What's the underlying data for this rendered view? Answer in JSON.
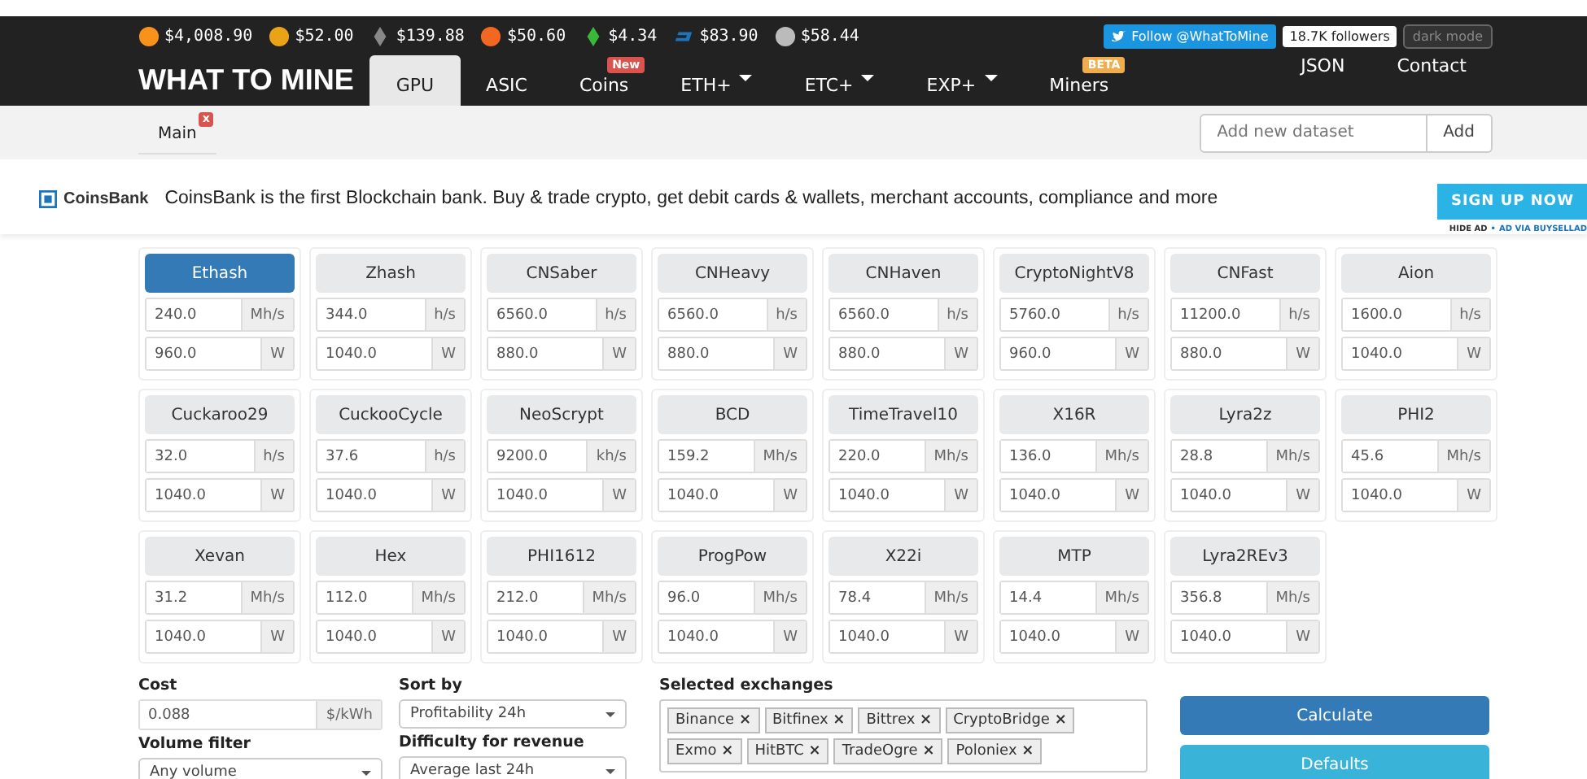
{
  "ticker": [
    {
      "kind": "bitcoin",
      "price": "$4,008.90"
    },
    {
      "kind": "zcash",
      "price": "$52.00"
    },
    {
      "kind": "ethereum",
      "price": "$139.88"
    },
    {
      "kind": "monero",
      "price": "$50.60"
    },
    {
      "kind": "classic",
      "price": "$4.34"
    },
    {
      "kind": "dash",
      "price": "$83.90"
    },
    {
      "kind": "litecoin",
      "price": "$58.44"
    }
  ],
  "social": {
    "follow": "Follow @WhatToMine",
    "followers": "18.7K followers",
    "dark_mode": "dark mode"
  },
  "brand": "WHAT TO MINE",
  "nav": [
    {
      "label": "GPU",
      "selected": true,
      "dropdown": false
    },
    {
      "label": "ASIC",
      "selected": false,
      "dropdown": false
    },
    {
      "label": "Coins",
      "selected": false,
      "dropdown": false,
      "badge": {
        "text": "New",
        "color": "#d9534f"
      }
    },
    {
      "label": "ETH+",
      "selected": false,
      "dropdown": true
    },
    {
      "label": "ETC+",
      "selected": false,
      "dropdown": true
    },
    {
      "label": "EXP+",
      "selected": false,
      "dropdown": true
    },
    {
      "label": "Miners",
      "selected": false,
      "dropdown": false,
      "badge": {
        "text": "BETA",
        "color": "#f0ad4e"
      }
    }
  ],
  "nav_right": [
    "JSON",
    "Contact"
  ],
  "datasets": [
    {
      "label": "Main",
      "selected": true,
      "close": "x"
    }
  ],
  "dataset_field": {
    "placeholder": "Add new dataset",
    "button": "Add"
  },
  "ad": {
    "brand": "CoinsBank",
    "text": "CoinsBank is the first Blockchain bank. Buy & trade crypto, get debit cards & wallets, merchant accounts, compliance and more",
    "cta": "SIGN UP NOW",
    "hide": "HIDE AD",
    "separator": "•",
    "via": "AD VIA BUYSELLAD"
  },
  "algorithms": [
    {
      "name": "Ethash",
      "selected": true,
      "hashrate": "240.0",
      "unit": "Mh/s",
      "power": "960.0",
      "power_unit": "W"
    },
    {
      "name": "Zhash",
      "selected": false,
      "hashrate": "344.0",
      "unit": "h/s",
      "power": "1040.0",
      "power_unit": "W"
    },
    {
      "name": "CNSaber",
      "selected": false,
      "hashrate": "6560.0",
      "unit": "h/s",
      "power": "880.0",
      "power_unit": "W"
    },
    {
      "name": "CNHeavy",
      "selected": false,
      "hashrate": "6560.0",
      "unit": "h/s",
      "power": "880.0",
      "power_unit": "W"
    },
    {
      "name": "CNHaven",
      "selected": false,
      "hashrate": "6560.0",
      "unit": "h/s",
      "power": "880.0",
      "power_unit": "W"
    },
    {
      "name": "CryptoNightV8",
      "selected": false,
      "hashrate": "5760.0",
      "unit": "h/s",
      "power": "960.0",
      "power_unit": "W"
    },
    {
      "name": "CNFast",
      "selected": false,
      "hashrate": "11200.0",
      "unit": "h/s",
      "power": "880.0",
      "power_unit": "W"
    },
    {
      "name": "Aion",
      "selected": false,
      "hashrate": "1600.0",
      "unit": "h/s",
      "power": "1040.0",
      "power_unit": "W"
    },
    {
      "name": "Cuckaroo29",
      "selected": false,
      "hashrate": "32.0",
      "unit": "h/s",
      "power": "1040.0",
      "power_unit": "W"
    },
    {
      "name": "CuckooCycle",
      "selected": false,
      "hashrate": "37.6",
      "unit": "h/s",
      "power": "1040.0",
      "power_unit": "W"
    },
    {
      "name": "NeoScrypt",
      "selected": false,
      "hashrate": "9200.0",
      "unit": "kh/s",
      "power": "1040.0",
      "power_unit": "W"
    },
    {
      "name": "BCD",
      "selected": false,
      "hashrate": "159.2",
      "unit": "Mh/s",
      "power": "1040.0",
      "power_unit": "W"
    },
    {
      "name": "TimeTravel10",
      "selected": false,
      "hashrate": "220.0",
      "unit": "Mh/s",
      "power": "1040.0",
      "power_unit": "W"
    },
    {
      "name": "X16R",
      "selected": false,
      "hashrate": "136.0",
      "unit": "Mh/s",
      "power": "1040.0",
      "power_unit": "W"
    },
    {
      "name": "Lyra2z",
      "selected": false,
      "hashrate": "28.8",
      "unit": "Mh/s",
      "power": "1040.0",
      "power_unit": "W"
    },
    {
      "name": "PHI2",
      "selected": false,
      "hashrate": "45.6",
      "unit": "Mh/s",
      "power": "1040.0",
      "power_unit": "W"
    },
    {
      "name": "Xevan",
      "selected": false,
      "hashrate": "31.2",
      "unit": "Mh/s",
      "power": "1040.0",
      "power_unit": "W"
    },
    {
      "name": "Hex",
      "selected": false,
      "hashrate": "112.0",
      "unit": "Mh/s",
      "power": "1040.0",
      "power_unit": "W"
    },
    {
      "name": "PHI1612",
      "selected": false,
      "hashrate": "212.0",
      "unit": "Mh/s",
      "power": "1040.0",
      "power_unit": "W"
    },
    {
      "name": "ProgPow",
      "selected": false,
      "hashrate": "96.0",
      "unit": "Mh/s",
      "power": "1040.0",
      "power_unit": "W"
    },
    {
      "name": "X22i",
      "selected": false,
      "hashrate": "78.4",
      "unit": "Mh/s",
      "power": "1040.0",
      "power_unit": "W"
    },
    {
      "name": "MTP",
      "selected": false,
      "hashrate": "14.4",
      "unit": "Mh/s",
      "power": "1040.0",
      "power_unit": "W"
    },
    {
      "name": "Lyra2REv3",
      "selected": false,
      "hashrate": "356.8",
      "unit": "Mh/s",
      "power": "1040.0",
      "power_unit": "W"
    }
  ],
  "cost": {
    "label": "Cost",
    "value": "0.088",
    "unit": "$/kWh"
  },
  "volume_filter": {
    "label": "Volume filter",
    "value": "Any volume"
  },
  "sort_by": {
    "label": "Sort by",
    "value": "Profitability 24h"
  },
  "difficulty": {
    "label": "Difficulty for revenue",
    "value": "Average last 24h"
  },
  "exchanges": {
    "label": "Selected exchanges",
    "items": [
      "Binance",
      "Bitfinex",
      "Bittrex",
      "CryptoBridge",
      "Exmo",
      "HitBTC",
      "TradeOgre",
      "Poloniex"
    ],
    "remove": "×"
  },
  "buttons": [
    {
      "label": "Calculate",
      "kind": "primary"
    },
    {
      "label": "Defaults",
      "kind": "info"
    }
  ]
}
